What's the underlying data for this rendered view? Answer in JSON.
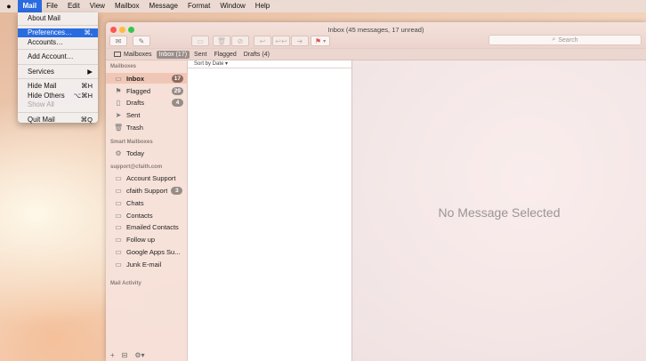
{
  "menubar": {
    "apple": "",
    "items": [
      "Mail",
      "File",
      "Edit",
      "View",
      "Mailbox",
      "Message",
      "Format",
      "Window",
      "Help"
    ]
  },
  "mail_menu": {
    "about": "About Mail",
    "preferences": "Preferences…",
    "preferences_shortcut": "⌘,",
    "accounts": "Accounts…",
    "add_account": "Add Account…",
    "services": "Services",
    "hide_mail": "Hide Mail",
    "hide_mail_shortcut": "⌘H",
    "hide_others": "Hide Others",
    "hide_others_shortcut": "⌥⌘H",
    "show_all": "Show All",
    "quit": "Quit Mail",
    "quit_shortcut": "⌘Q"
  },
  "window": {
    "title": "Inbox (45 messages, 17 unread)",
    "search_placeholder": "Search"
  },
  "favorites": {
    "mailboxes": "Mailboxes",
    "inbox": "Inbox (17)",
    "sent": "Sent",
    "flagged": "Flagged",
    "drafts": "Drafts (4)"
  },
  "sidebar": {
    "mailboxes_heading": "Mailboxes",
    "inbox": {
      "label": "Inbox",
      "count": "17"
    },
    "flagged": {
      "label": "Flagged",
      "count": "29"
    },
    "drafts": {
      "label": "Drafts",
      "count": "4"
    },
    "sent": "Sent",
    "trash": "Trash",
    "smart_heading": "Smart Mailboxes",
    "today": "Today",
    "account_heading": "support@cfaith.com",
    "folders": [
      {
        "label": "Account Support"
      },
      {
        "label": "cfaith Support",
        "count": "3"
      },
      {
        "label": "Chats"
      },
      {
        "label": "Contacts"
      },
      {
        "label": "Emailed Contacts"
      },
      {
        "label": "Follow up"
      },
      {
        "label": "Google Apps Su..."
      },
      {
        "label": "Junk E-mail"
      }
    ],
    "activity_heading": "Mail Activity"
  },
  "message_list": {
    "sort_label": "Sort by Date"
  },
  "preview": {
    "empty_text": "No Message Selected"
  },
  "colors": {
    "accent": "#2a6ce0",
    "selected_row": "#f0c7b6",
    "badge": "#978c88"
  }
}
